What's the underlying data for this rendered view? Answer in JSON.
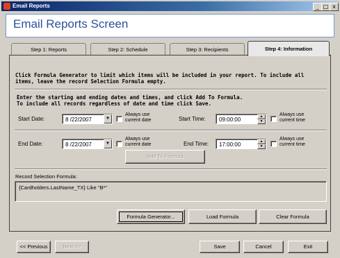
{
  "window": {
    "title": "Email Reports",
    "minimize": "_",
    "maximize": "□",
    "close": "x"
  },
  "header": {
    "title": "Email Reports Screen"
  },
  "tabs": [
    {
      "label": "Step 1: Reports"
    },
    {
      "label": "Step 2: Schedule"
    },
    {
      "label": "Step 3: Recipients"
    },
    {
      "label": "Step 4: Information"
    }
  ],
  "info": {
    "line1": "Click Formula Generator to limit which items will be included in your report.  To include all",
    "line2": "items, leave the record Selection Formula empty.",
    "instr1": "Enter the starting and ending  dates and times, and click Add To Formula.",
    "instr2": "To include all records regardless of date and time click Save."
  },
  "start": {
    "date_label": "Start Date:",
    "date_value": "8 /22/2007",
    "always_date_1": "Always use",
    "always_date_2": "current date",
    "time_label": "Start Time:",
    "time_value": "09:00:00",
    "always_time_1": "Always use",
    "always_time_2": "current time"
  },
  "end": {
    "date_label": "End Date:",
    "date_value": "8 /22/2007",
    "always_date_1": "Always use",
    "always_date_2": "current date",
    "time_label": "End Time:",
    "time_value": "17:00:00",
    "always_time_1": "Always use",
    "always_time_2": "current time"
  },
  "add_to_formula": "Add To Formula",
  "formula": {
    "label": "Record Selection Formula:",
    "value": "{Cardholders.LastName_TX} Like \"B*\""
  },
  "buttons": {
    "formula_generator": "Formula Generator...",
    "load_formula": "Load Formula",
    "clear_formula": "Clear Formula"
  },
  "nav": {
    "previous": "<< Previous",
    "next": "Next >>",
    "save": "Save",
    "cancel": "Cancel",
    "exit": "Exit"
  }
}
